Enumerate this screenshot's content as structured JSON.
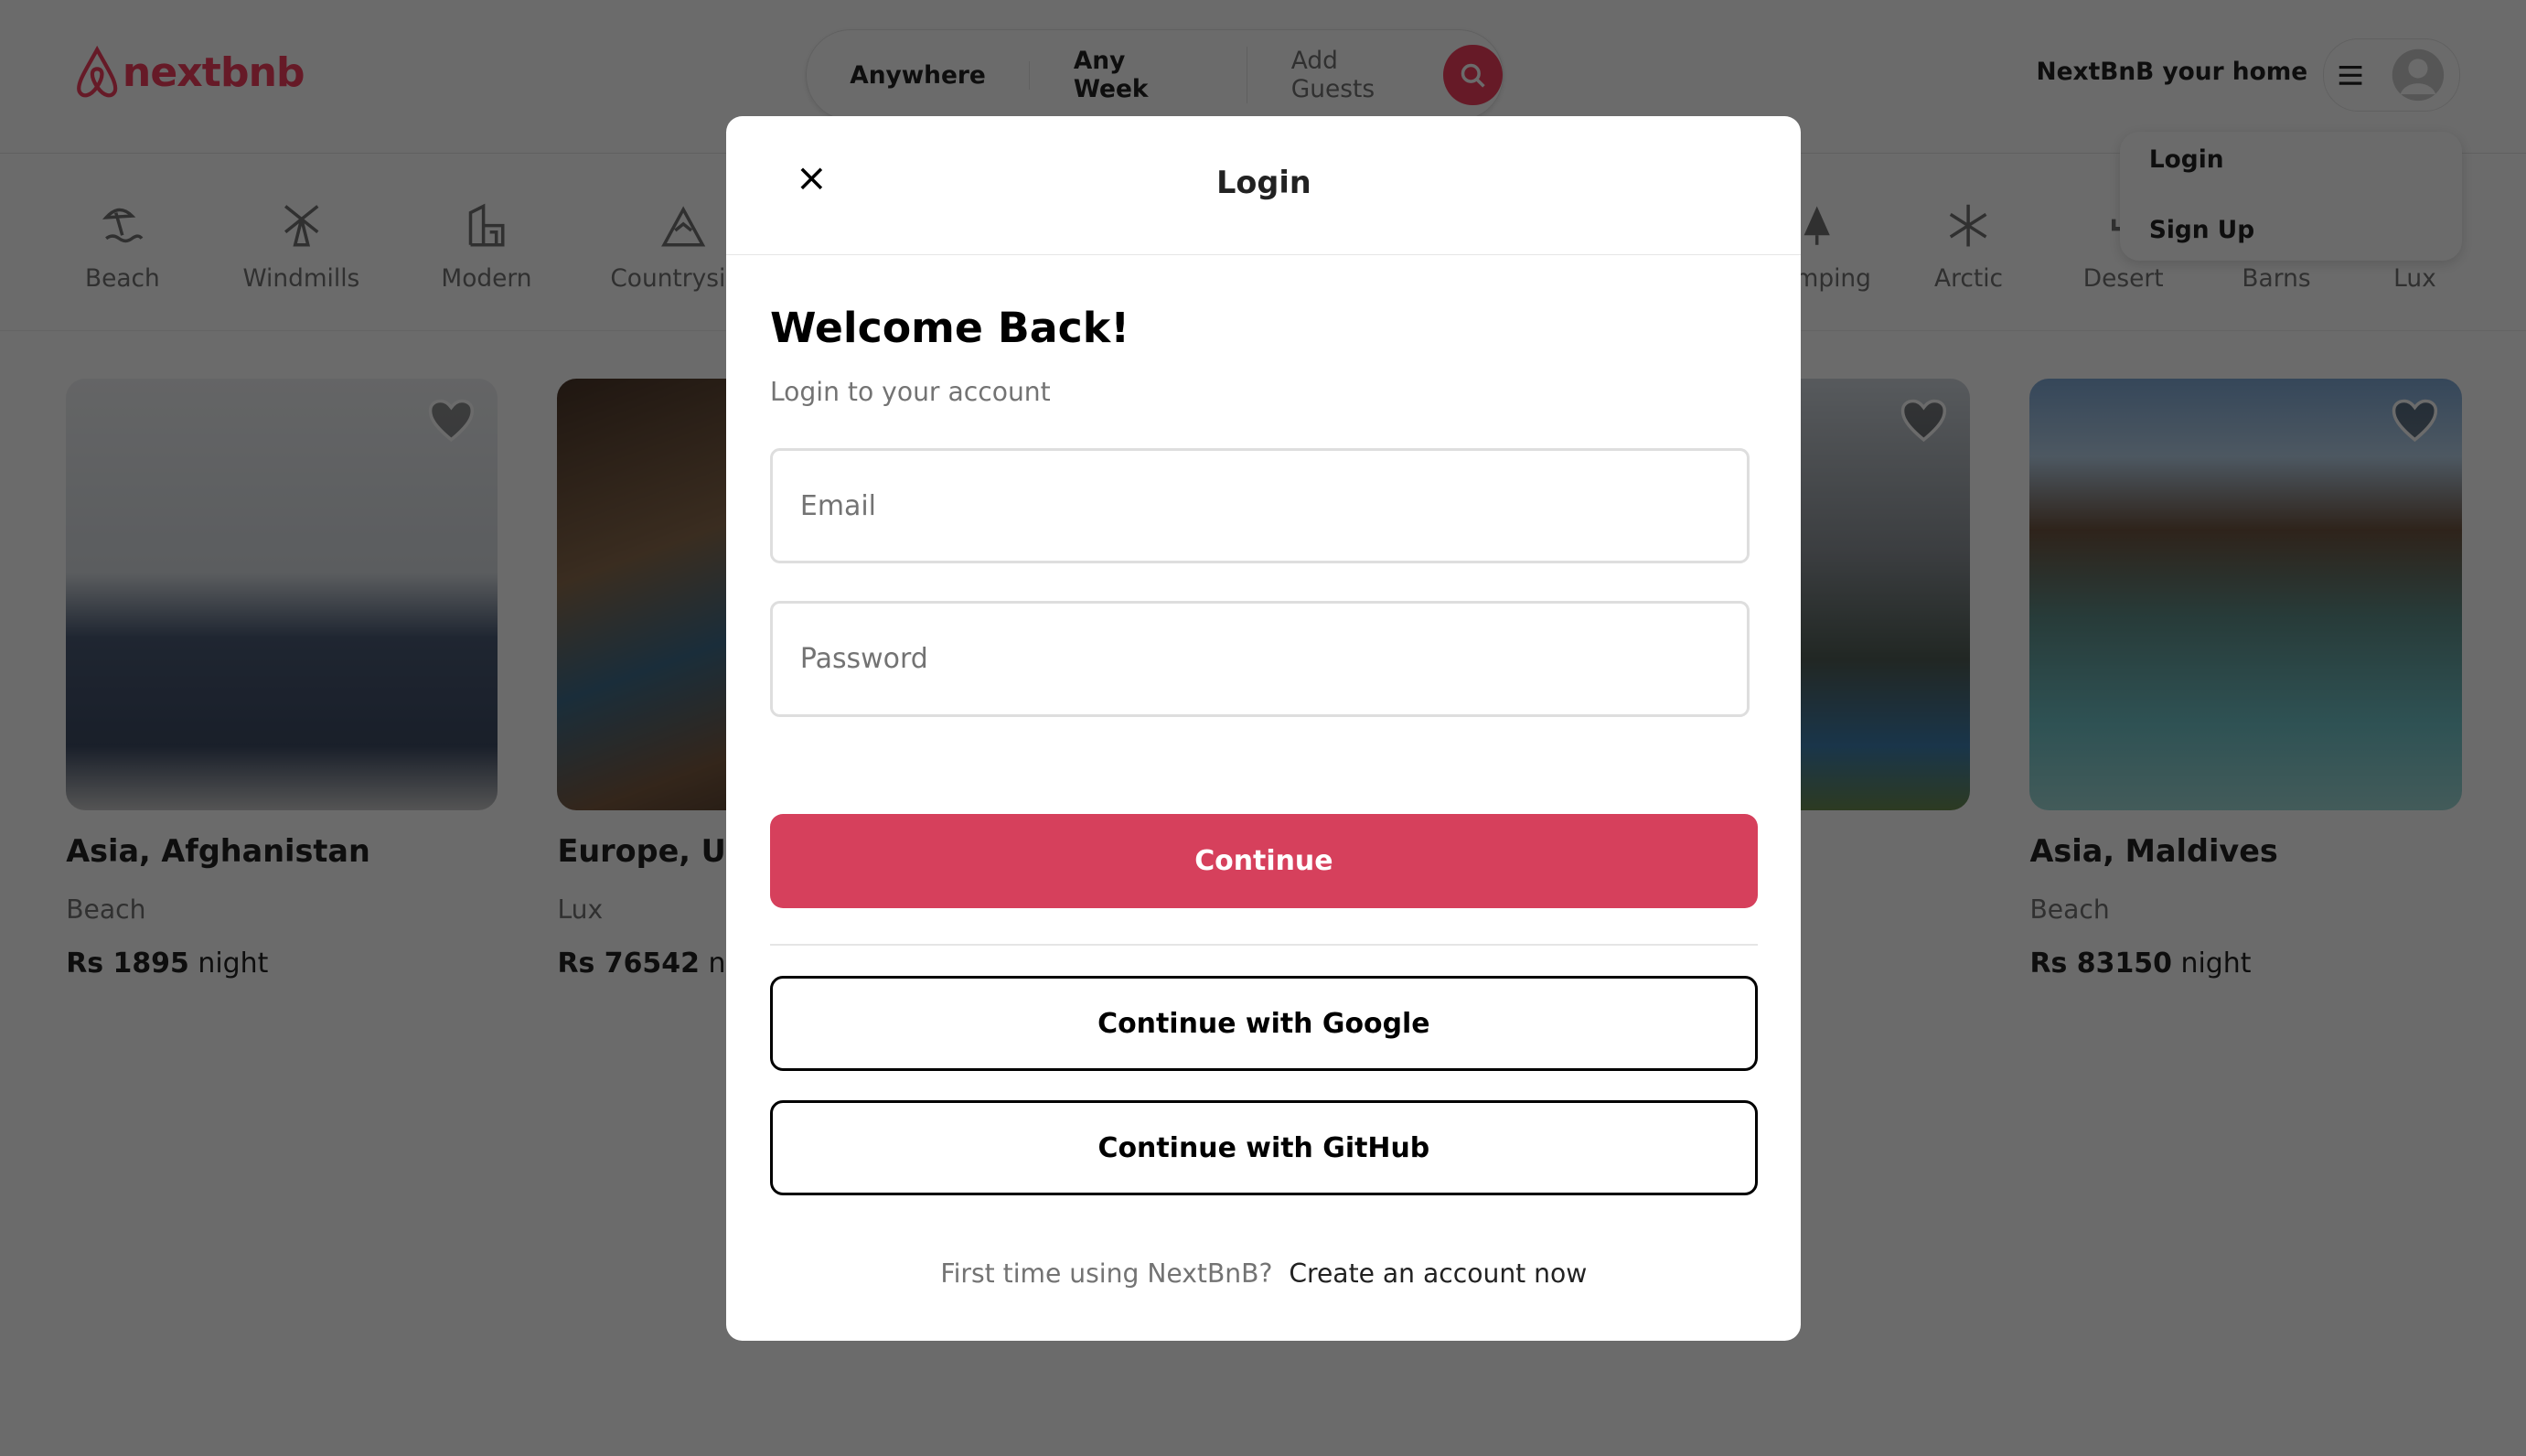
{
  "header": {
    "logo": "nextbnb",
    "search": {
      "location": "Anywhere",
      "week": "Any Week",
      "guests": "Add Guests"
    },
    "host_link": "NextBnB your home"
  },
  "user_menu": {
    "items": [
      {
        "label": "Login"
      },
      {
        "label": "Sign Up"
      }
    ]
  },
  "categories": [
    {
      "label": "Beach",
      "icon": "beach-icon"
    },
    {
      "label": "Windmills",
      "icon": "windmill-icon"
    },
    {
      "label": "Modern",
      "icon": "modern-icon"
    },
    {
      "label": "Countryside",
      "icon": "mountain-icon"
    },
    {
      "label": "Camping",
      "icon": "tree-icon"
    },
    {
      "label": "Arctic",
      "icon": "snowflake-icon"
    },
    {
      "label": "Desert",
      "icon": "cactus-icon"
    },
    {
      "label": "Barns",
      "icon": "barn-icon"
    },
    {
      "label": "Lux",
      "icon": "diamond-icon"
    }
  ],
  "listings": [
    {
      "title": "Asia, Afghanistan",
      "category": "Beach",
      "price": "Rs 1895",
      "unit": "night"
    },
    {
      "title": "Europe, Uni",
      "category": "Lux",
      "price": "Rs 76542",
      "unit": "night"
    },
    {
      "title": "",
      "category": "",
      "price": "",
      "unit": ""
    },
    {
      "title": "Asia, Maldives",
      "category": "Beach",
      "price": "Rs 83150",
      "unit": "night"
    }
  ],
  "modal": {
    "title": "Login",
    "heading": "Welcome Back!",
    "subheading": "Login to your account",
    "email_placeholder": "Email",
    "password_placeholder": "Password",
    "continue": "Continue",
    "google": "Continue with Google",
    "github": "Continue with GitHub",
    "footer_text": "First time using NextBnB?",
    "footer_link": "Create an account now"
  },
  "colors": {
    "brand": "#f43f5e",
    "primary_button": "#d6405c"
  }
}
